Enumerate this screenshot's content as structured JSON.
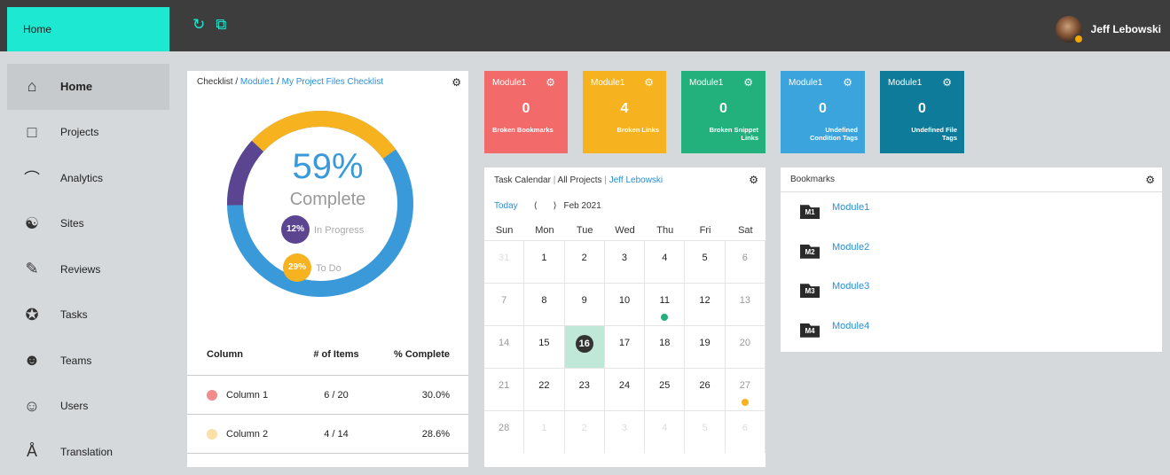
{
  "header": {
    "home_tab": "Home",
    "refresh_icon": "refresh-icon",
    "new_icon": "new-window-icon",
    "user_name": "Jeff Lebowski"
  },
  "sidebar": {
    "items": [
      {
        "label": "Home",
        "icon": "home-icon",
        "active": true
      },
      {
        "label": "Projects",
        "icon": "folder-icon"
      },
      {
        "label": "Analytics",
        "icon": "analytics-icon"
      },
      {
        "label": "Sites",
        "icon": "globe-icon"
      },
      {
        "label": "Reviews",
        "icon": "pen-icon"
      },
      {
        "label": "Tasks",
        "icon": "pin-icon"
      },
      {
        "label": "Teams",
        "icon": "teams-icon"
      },
      {
        "label": "Users",
        "icon": "user-icon"
      },
      {
        "label": "Translation",
        "icon": "translate-icon"
      }
    ]
  },
  "checklist": {
    "crumb_root": "Checklist",
    "crumb_sep": "/",
    "crumb_module": "Module1",
    "crumb_file": "My Project Files Checklist",
    "percent": "59%",
    "complete_label": "Complete",
    "in_progress_pct": "12%",
    "in_progress_label": "In Progress",
    "todo_pct": "29%",
    "todo_label": "To Do",
    "table": {
      "headers": [
        "Column",
        "# of Items",
        "% Complete"
      ],
      "rows": [
        {
          "name": "Column 1",
          "items": "6 / 20",
          "pct": "30.0%",
          "color": "#f28b8b"
        },
        {
          "name": "Column 2",
          "items": "4 / 14",
          "pct": "28.6%",
          "color": "#fbe0a8"
        }
      ]
    },
    "colors": {
      "complete": "#3a9ad9",
      "in_progress": "#5c4590",
      "todo": "#f7b21f"
    }
  },
  "tiles": [
    {
      "title": "Module1",
      "count": "0",
      "label": "Broken Bookmarks",
      "color": "#f36a6a"
    },
    {
      "title": "Module1",
      "count": "4",
      "label": "Broken Links",
      "color": "#f7b21f"
    },
    {
      "title": "Module1",
      "count": "0",
      "label": "Broken Snippet Links",
      "color": "#22b07d"
    },
    {
      "title": "Module1",
      "count": "0",
      "label": "Undefined Condition Tags",
      "color": "#3ca4dd"
    },
    {
      "title": "Module1",
      "count": "0",
      "label": "Undefined File Tags",
      "color": "#0e7b9a"
    }
  ],
  "calendar": {
    "title": "Task Calendar",
    "sep": "|",
    "project": "All Projects",
    "user": "Jeff Lebowski",
    "today": "Today",
    "prev": "⟨",
    "next": "⟩",
    "month": "Feb 2021",
    "weekdays": [
      "Sun",
      "Mon",
      "Tue",
      "Wed",
      "Thu",
      "Fri",
      "Sat"
    ],
    "weeks": [
      [
        "31",
        "1",
        "2",
        "3",
        "4",
        "5",
        "6"
      ],
      [
        "7",
        "8",
        "9",
        "10",
        "11",
        "12",
        "13"
      ],
      [
        "14",
        "15",
        "16",
        "17",
        "18",
        "19",
        "20"
      ],
      [
        "21",
        "22",
        "23",
        "24",
        "25",
        "26",
        "27"
      ],
      [
        "28",
        "1",
        "2",
        "3",
        "4",
        "5",
        "6"
      ]
    ],
    "today_day": "16",
    "events": [
      {
        "day": "11",
        "color": "#22b07d"
      },
      {
        "day": "27",
        "color": "#f7b21f"
      }
    ]
  },
  "bookmarks": {
    "title": "Bookmarks",
    "items": [
      {
        "tag": "M1",
        "label": "Module1"
      },
      {
        "tag": "M2",
        "label": "Module2"
      },
      {
        "tag": "M3",
        "label": "Module3"
      },
      {
        "tag": "M4",
        "label": "Module4"
      }
    ]
  }
}
